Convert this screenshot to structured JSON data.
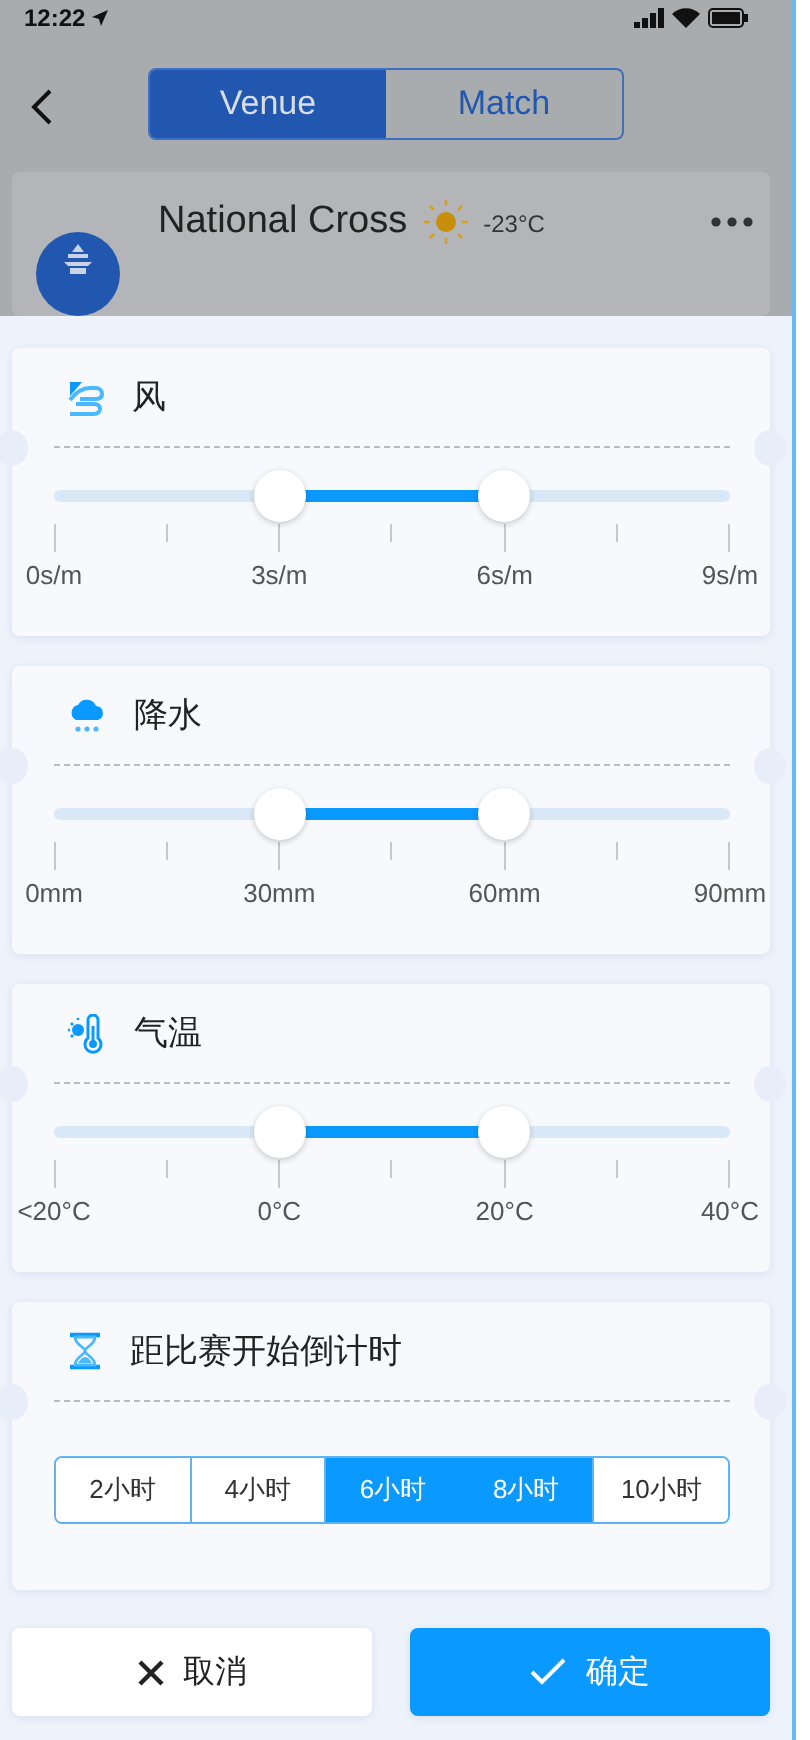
{
  "status_bar": {
    "time": "12:22"
  },
  "nav": {
    "tabs": [
      {
        "label": "Venue",
        "selected": true
      },
      {
        "label": "Match",
        "selected": false
      }
    ]
  },
  "venue_card": {
    "name": "National Cross",
    "temperature": "-23°C"
  },
  "filters": [
    {
      "kind": "wind",
      "title": "风",
      "handles": [
        {
          "level": 0.333
        },
        {
          "level": 0.667
        }
      ],
      "tick_labels": [
        "0s/m",
        "3s/m",
        "6s/m",
        "9s/m"
      ]
    },
    {
      "kind": "precipitation",
      "title": "降水",
      "handles": [
        {
          "level": 0.333
        },
        {
          "level": 0.667
        }
      ],
      "tick_labels": [
        "0mm",
        "30mm",
        "60mm",
        "90mm"
      ]
    },
    {
      "kind": "temperature",
      "title": "气温",
      "handles": [
        {
          "level": 0.333
        },
        {
          "level": 0.667
        }
      ],
      "tick_labels": [
        "<20°C",
        "0°C",
        "20°C",
        "40°C"
      ]
    },
    {
      "kind": "countdown",
      "title": "距比赛开始倒计时",
      "options": [
        {
          "label": "2小时",
          "selected": false
        },
        {
          "label": "4小时",
          "selected": false
        },
        {
          "label": "6小时",
          "selected": true
        },
        {
          "label": "8小时",
          "selected": true
        },
        {
          "label": "10小时",
          "selected": false
        }
      ]
    }
  ],
  "actions": [
    {
      "kind": "cancel",
      "label": "取消"
    },
    {
      "kind": "confirm",
      "label": "确定"
    }
  ]
}
